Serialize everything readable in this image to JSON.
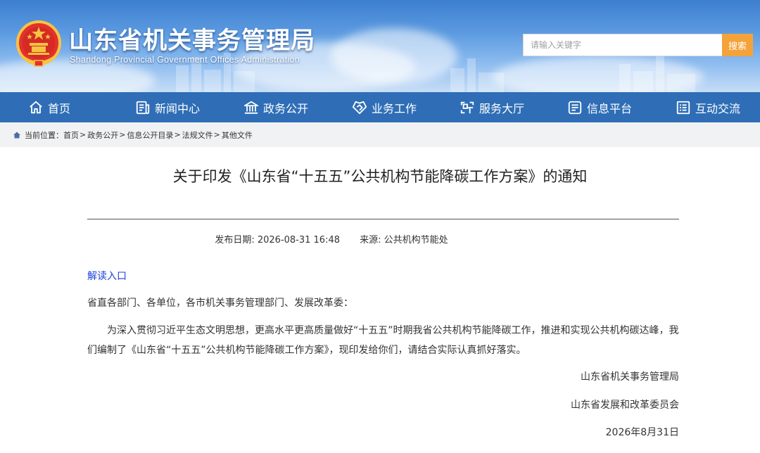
{
  "header": {
    "title": "山东省机关事务管理局",
    "subtitle": "Shandong Provincial Government Offices Administration",
    "search_placeholder": "请输入关键字",
    "search_button": "搜索"
  },
  "nav": {
    "items": [
      {
        "label": "首页",
        "icon": "home-icon"
      },
      {
        "label": "新闻中心",
        "icon": "news-icon"
      },
      {
        "label": "政务公开",
        "icon": "government-building-icon"
      },
      {
        "label": "业务工作",
        "icon": "handshake-icon"
      },
      {
        "label": "服务大厅",
        "icon": "service-hall-icon"
      },
      {
        "label": "信息平台",
        "icon": "info-platform-icon"
      },
      {
        "label": "互动交流",
        "icon": "interaction-list-icon"
      }
    ]
  },
  "breadcrumb": {
    "prefix": "当前位置：",
    "items": [
      "首页",
      "政务公开",
      "信息公开目录",
      "法规文件",
      "其他文件"
    ],
    "separator": ">"
  },
  "article": {
    "title": "关于印发《山东省“十五五”公共机构节能降碳工作方案》的通知",
    "publish_label": "发布日期:",
    "publish_date": "2026-08-31  16:48",
    "source_label": "来源:",
    "source": "公共机构节能处",
    "read_link": "解读入口",
    "addressee": "省直各部门、各单位，各市机关事务管理部门、发展改革委：",
    "body": "为深入贯彻习近平生态文明思想，更高水平更高质量做好“十五五”时期我省公共机构节能降碳工作，推进和实现公共机构碳达峰，我们编制了《山东省“十五五”公共机构节能降碳工作方案》，现印发给你们，请结合实际认真抓好落实。",
    "signatures": [
      "山东省机关事务管理局",
      "山东省发展和改革委员会",
      "2026年8月31日"
    ]
  },
  "colors": {
    "nav_bg": "#2f6eb6",
    "search_button": "#f3a33a",
    "link": "#1a3fd8",
    "breadcrumb_bg": "#f1f2f4"
  }
}
